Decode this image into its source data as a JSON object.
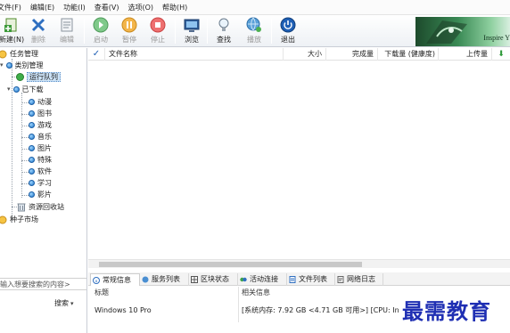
{
  "menu": [
    "文件(F)",
    "编辑(E)",
    "功能(I)",
    "查看(V)",
    "选项(O)",
    "帮助(H)"
  ],
  "toolbar": {
    "new": "新建(N)",
    "delete": "删除",
    "edit": "编辑",
    "start": "启动",
    "pause": "暂停",
    "stop": "停止",
    "browse": "浏览",
    "find": "查找",
    "play": "播放",
    "exit": "退出"
  },
  "banner": {
    "text": "Inspire Y"
  },
  "tree": {
    "root": "任务管理",
    "category": "类别管理",
    "running": "运行队列",
    "downloaded": "已下载",
    "children": [
      "动漫",
      "图书",
      "游戏",
      "音乐",
      "图片",
      "特殊",
      "软件",
      "学习",
      "影片"
    ],
    "recycle": "资源回收站",
    "market": "种子市场"
  },
  "search": {
    "placeholder": "输入想要搜索的内容>",
    "button": "搜索"
  },
  "list_columns": [
    "文件名称",
    "大小",
    "完成量",
    "下载量 (健康度)",
    "上传量"
  ],
  "tabs": [
    "常规信息",
    "服务列表",
    "区块状态",
    "活动连接",
    "文件列表",
    "网络日志"
  ],
  "detail": {
    "col1": "标题",
    "col2": "相关信息",
    "row1_left": "Windows 10 Pro",
    "row1_right": "[系统内存: 7.92 GB <4.71 GB 可用>] [CPU: In"
  },
  "watermark": "最需教育",
  "colors": {
    "accent": "#1f75c9",
    "selection": "#cde3f7",
    "watermark": "#1f2fb3"
  }
}
